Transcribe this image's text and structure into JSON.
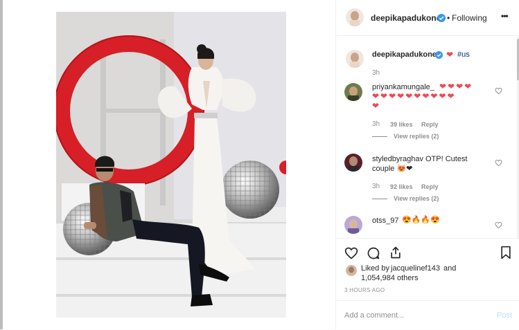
{
  "post": {
    "author": "deepikapadukone",
    "follow_sep": "•",
    "follow_status": "Following",
    "more_label": "•••"
  },
  "caption": {
    "author": "deepikapadukone",
    "heart": "❤",
    "hashtag": "#us",
    "time": "3h"
  },
  "comments": [
    {
      "user": "priyankamungale_",
      "line1": "❤❤❤❤",
      "line2": "❤❤❤❤❤❤❤❤❤❤",
      "line3": "❤",
      "time": "3h",
      "likes": "39 likes",
      "reply": "Reply",
      "view_replies": "View replies (2)"
    },
    {
      "user": "styledbyraghav",
      "text": "OTP! Cutest",
      "line2": "couple 😻❤",
      "time": "3h",
      "likes": "92 likes",
      "reply": "Reply",
      "view_replies": "View replies (2)"
    },
    {
      "user": "otss_97",
      "text": "😍🔥🔥😍"
    }
  ],
  "likes": {
    "prefix": "Liked by",
    "user": "jacquelinef143",
    "and": "and",
    "count": "1,054,984 others",
    "time": "3 HOURS AGO"
  },
  "comment_box": {
    "placeholder": "Add a comment...",
    "post_label": "Post"
  },
  "icons": {
    "verified": "verified-badge-icon",
    "like": "heart-icon",
    "comment": "comment-bubble-icon",
    "share": "share-icon",
    "save": "bookmark-icon"
  },
  "colors": {
    "link_blue": "#3897f0",
    "heart_red": "#ed4956",
    "text": "#262626",
    "muted": "#8e8e8e"
  }
}
